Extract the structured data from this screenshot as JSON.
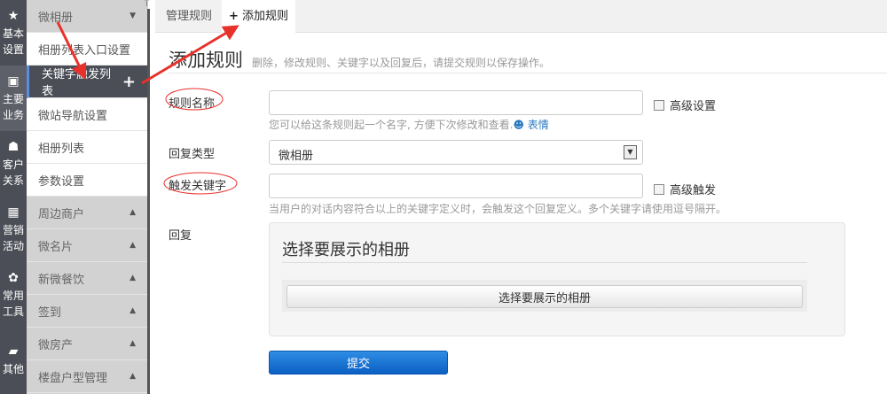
{
  "iconbar": [
    {
      "icon": "star-icon",
      "label": "基本设置"
    },
    {
      "icon": "briefcase-icon",
      "label": "主要业务"
    },
    {
      "icon": "sitemap-icon",
      "label": "客户关系"
    },
    {
      "icon": "gift-icon",
      "label": "营销活动"
    },
    {
      "icon": "gear-icon",
      "label": "常用工具"
    },
    {
      "icon": "folder-open-icon",
      "label": "其他"
    }
  ],
  "submenu": {
    "group": "微相册",
    "children": [
      "相册列表入口设置",
      "关键字触发列表",
      "微站导航设置",
      "相册列表",
      "参数设置"
    ],
    "groups": [
      "周边商户",
      "微名片",
      "新微餐饮",
      "签到",
      "微房产",
      "楼盘户型管理"
    ]
  },
  "tabs": {
    "manage": "管理规则",
    "add": "添加规则"
  },
  "page": {
    "title": "添加规则",
    "subtitle": "删除，修改规则、关键字以及回复后，请提交规则以保存操作。"
  },
  "form": {
    "rule_name_label": "规则名称",
    "rule_name_value": "",
    "advanced_settings": "高级设置",
    "rule_help": "您可以给这条规则起一个名字, 方便下次修改和查看.",
    "emoji_link": "表情",
    "reply_type_label": "回复类型",
    "reply_type_value": "微相册",
    "keyword_label": "触发关键字",
    "keyword_value": "",
    "advanced_trigger": "高级触发",
    "keyword_help": "当用户的对话内容符合以上的关键字定义时，会触发这个回复定义。多个关键字请使用逗号隔开。",
    "reply_label": "回复",
    "panel_title": "选择要展示的相册",
    "panel_button": "选择要展示的相册",
    "submit": "提交"
  },
  "colors": {
    "annotation": "#e8312b",
    "primary": "#0b5fc4",
    "sidebar": "#4b4e56"
  }
}
